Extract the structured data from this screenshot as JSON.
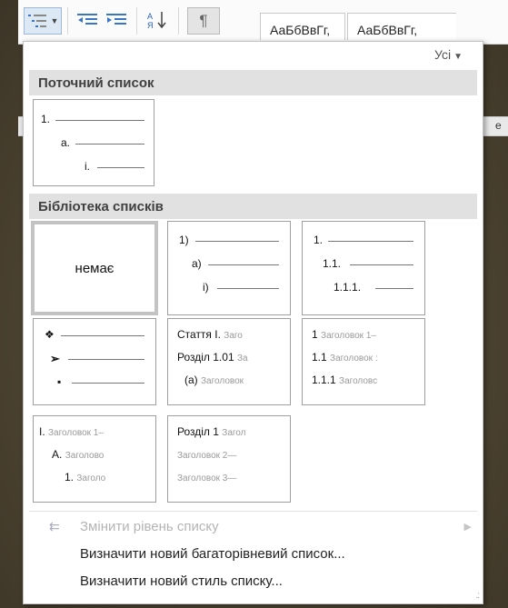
{
  "ribbon": {
    "style1": "АаБбВвГг,",
    "style2": "АаБбВвГг,"
  },
  "gallery": {
    "filter_label": "Усі"
  },
  "current_list": {
    "heading": "Поточний список",
    "levels": [
      "1.",
      "a.",
      "i."
    ]
  },
  "library": {
    "heading": "Бібліотека списків",
    "none_label": "немає",
    "tile2": [
      "1)",
      "a)",
      "i)"
    ],
    "tile3": [
      "1.",
      "1.1.",
      "1.1.1."
    ],
    "tile5": {
      "r1a": "Стаття I.",
      "r1b": "Заго",
      "r2a": "Розділ 1.01",
      "r2b": "За",
      "r3a": "(a)",
      "r3b": "Заголовок"
    },
    "tile6": {
      "r1a": "1",
      "r1b": "Заголовок 1–",
      "r2a": "1.1",
      "r2b": "Заголовок :",
      "r3a": "1.1.1",
      "r3b": "Заголовс"
    },
    "tile7": {
      "r1a": "I.",
      "r1b": "Заголовок 1–",
      "r2a": "A.",
      "r2b": "Заголово",
      "r3a": "1.",
      "r3b": "Заголо"
    },
    "tile8": {
      "r1a": "Розділ 1",
      "r1b": "Загол",
      "r2": "Заголовок 2—",
      "r3": "Заголовок 3—"
    }
  },
  "menu": {
    "change_level": "Змінити рівень списку",
    "define_multilevel": "Визначити новий багаторівневий список...",
    "define_style": "Визначити новий стиль списку..."
  }
}
